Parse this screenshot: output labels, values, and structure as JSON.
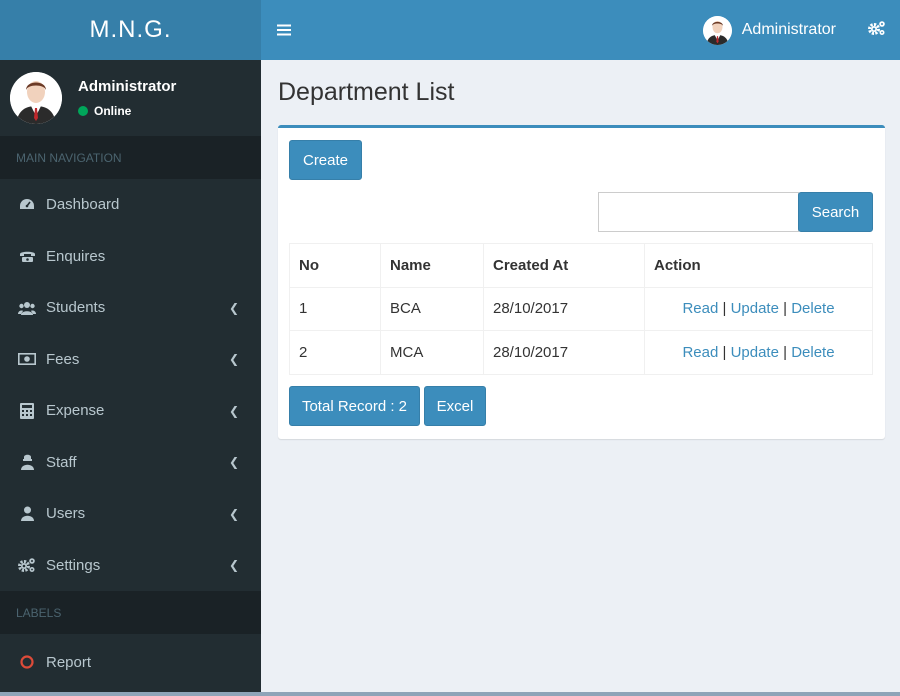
{
  "sidebar": {
    "logo": "M.N.G.",
    "user": {
      "name": "Administrator",
      "status": "Online"
    },
    "section_main": "MAIN NAVIGATION",
    "items": [
      {
        "label": "Dashboard",
        "icon": "dashboard-icon",
        "has_arrow": false
      },
      {
        "label": "Enquires",
        "icon": "phone-icon",
        "has_arrow": false
      },
      {
        "label": "Students",
        "icon": "users-icon",
        "has_arrow": true
      },
      {
        "label": "Fees",
        "icon": "money-icon",
        "has_arrow": true
      },
      {
        "label": "Expense",
        "icon": "calculator-icon",
        "has_arrow": true
      },
      {
        "label": "Staff",
        "icon": "staff-icon",
        "has_arrow": true
      },
      {
        "label": "Users",
        "icon": "user-icon",
        "has_arrow": true
      },
      {
        "label": "Settings",
        "icon": "gear-icon",
        "has_arrow": true
      }
    ],
    "section_labels": "LABELS",
    "report": {
      "label": "Report",
      "color": "#dd4b39"
    }
  },
  "header": {
    "user_name": "Administrator",
    "menu_icon": "hamburger-icon",
    "settings_icon": "gears-icon"
  },
  "page": {
    "title": "Department List",
    "create_label": "Create",
    "search": {
      "value": "",
      "placeholder": "",
      "button_label": "Search"
    },
    "table": {
      "columns": [
        "No",
        "Name",
        "Created At",
        "Action"
      ],
      "rows": [
        {
          "no": "1",
          "name": "BCA",
          "created_at": "28/10/2017"
        },
        {
          "no": "2",
          "name": "MCA",
          "created_at": "28/10/2017"
        }
      ],
      "action_labels": {
        "read": "Read",
        "update": "Update",
        "delete": "Delete",
        "separator": "|"
      }
    },
    "total_record_label": "Total Record : 2",
    "excel_label": "Excel"
  },
  "colors": {
    "primary": "#3c8dbc",
    "primary_dark": "#367fa9",
    "sidebar_bg": "#222d32",
    "online": "#00a65a"
  }
}
